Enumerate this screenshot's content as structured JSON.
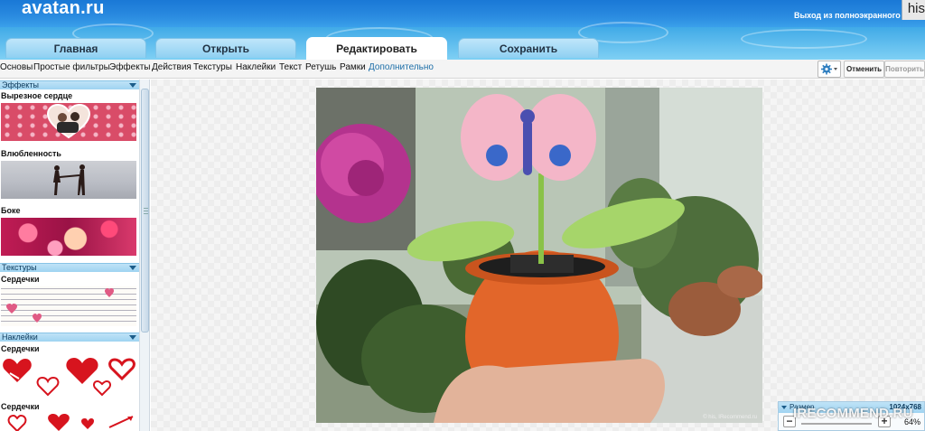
{
  "header": {
    "logo": "avatan.ru",
    "exit_fullscreen": "Выход из полноэкранного режима",
    "user": "his"
  },
  "tabs": [
    {
      "label": "Главная",
      "active": false
    },
    {
      "label": "Открыть",
      "active": false
    },
    {
      "label": "Редактировать",
      "active": true
    },
    {
      "label": "Сохранить",
      "active": false
    }
  ],
  "toolbar": {
    "menu": [
      "Основы",
      "Простые фильтры",
      "Эффекты",
      "Действия",
      "Текстуры",
      "Наклейки",
      "Текст",
      "Ретушь",
      "Рамки",
      "Дополнительно"
    ],
    "settings_icon": "gear-icon",
    "undo": "Отменить",
    "redo": "Повторить"
  },
  "sidebar": {
    "sections": [
      {
        "title": "Эффекты",
        "items": [
          "Вырезное сердце",
          "Влюбленность",
          "Боке"
        ]
      },
      {
        "title": "Текстуры",
        "items": [
          "Сердечки"
        ]
      },
      {
        "title": "Наклейки",
        "items": [
          "Сердечки",
          "Сердечки"
        ]
      }
    ]
  },
  "canvas": {
    "photo_caption": "© his, IRecommend.ru"
  },
  "zoom": {
    "label": "Размер",
    "resolution": "1024х768",
    "percent": "64%",
    "minus": "−",
    "plus": "+"
  },
  "overlay": {
    "site_watermark": "IRECOMMEND.RU"
  },
  "colors": {
    "accent": "#1c6ea8",
    "header_blue": "#2a8be0",
    "section_header": "#bfe3f7"
  }
}
